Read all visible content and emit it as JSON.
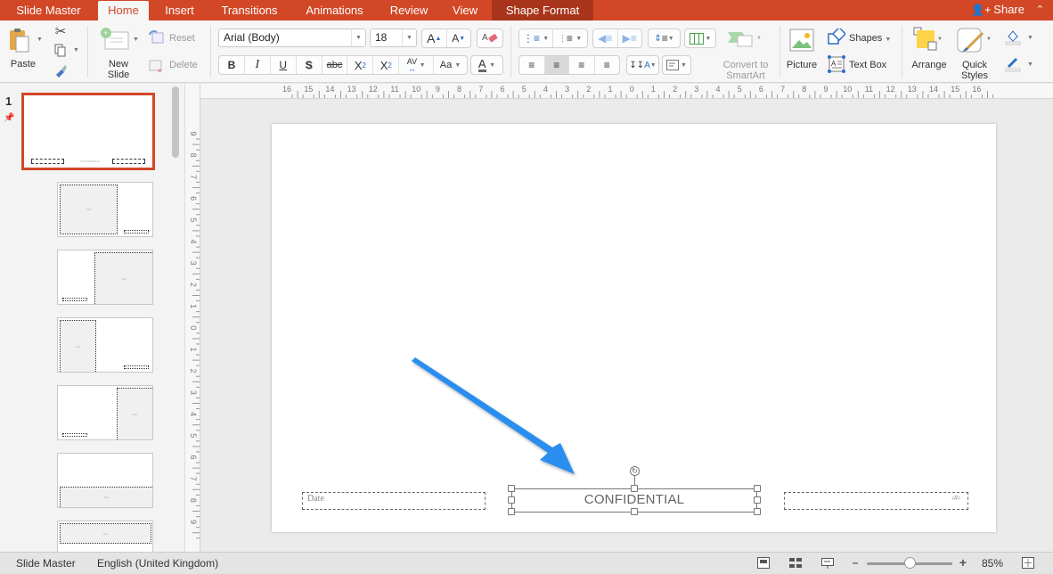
{
  "tabs": [
    {
      "label": "Slide Master",
      "state": "normal"
    },
    {
      "label": "Home",
      "state": "active"
    },
    {
      "label": "Insert",
      "state": "normal"
    },
    {
      "label": "Transitions",
      "state": "normal"
    },
    {
      "label": "Animations",
      "state": "normal"
    },
    {
      "label": "Review",
      "state": "normal"
    },
    {
      "label": "View",
      "state": "normal"
    },
    {
      "label": "Shape Format",
      "state": "contextual"
    }
  ],
  "share": {
    "label": "Share",
    "icon": "add-person-icon"
  },
  "colors": {
    "accent": "#d24726",
    "contextual_tab": "#a8341b",
    "arrow": "#2b8ef0",
    "ribbon_bg": "#f6f6f6"
  },
  "ribbon": {
    "clipboard": {
      "paste": "Paste",
      "cut_icon": "scissors-icon",
      "copy_icon": "copy-icon",
      "format_painter_icon": "paintbrush-icon"
    },
    "slides": {
      "new_slide": "New Slide",
      "reset": "Reset",
      "delete": "Delete"
    },
    "font": {
      "name": "Arial (Body)",
      "size": "18",
      "grow": "A",
      "shrink": "A",
      "bold": "B",
      "italic": "I",
      "underline": "U",
      "shadow": "S",
      "strike": "abc",
      "superscript": "X",
      "subscript": "X",
      "sup_mark": "2",
      "sub_mark": "2",
      "spacing": "AV",
      "change_case": "Aa",
      "color": "A"
    },
    "paragraph": {
      "convert_smartart_line1": "Convert to",
      "convert_smartart_line2": "SmartArt",
      "alignment_selected": "center"
    },
    "insert": {
      "picture": "Picture",
      "shapes": "Shapes",
      "text_box": "Text Box"
    },
    "drawing": {
      "arrange": "Arrange",
      "quick_styles_line1": "Quick",
      "quick_styles_line2": "Styles"
    }
  },
  "thumbnails": {
    "slide_number": "1",
    "items": [
      {
        "layout": "master",
        "selected": true
      },
      {
        "layout": "picture-left"
      },
      {
        "layout": "picture-right"
      },
      {
        "layout": "narrow-left"
      },
      {
        "layout": "narrow-right"
      },
      {
        "layout": "bottom-band"
      },
      {
        "layout": "top-band"
      }
    ],
    "placeholder_text": "Text"
  },
  "rulers": {
    "horizontal": [
      "16",
      "15",
      "14",
      "13",
      "12",
      "11",
      "10",
      "9",
      "8",
      "7",
      "6",
      "5",
      "4",
      "3",
      "2",
      "1",
      "0",
      "1",
      "2",
      "3",
      "4",
      "5",
      "6",
      "7",
      "8",
      "9",
      "10",
      "11",
      "12",
      "13",
      "14",
      "15",
      "16"
    ],
    "vertical": [
      "9",
      "8",
      "7",
      "6",
      "5",
      "4",
      "3",
      "2",
      "1",
      "0",
      "1",
      "2",
      "3",
      "4",
      "5",
      "6",
      "7",
      "8",
      "9"
    ]
  },
  "slide": {
    "date_placeholder": "Date",
    "footer_text": "CONFIDENTIAL",
    "slide_number_placeholder": "‹#›"
  },
  "status": {
    "view": "Slide Master",
    "language": "English (United Kingdom)",
    "zoom": "85%",
    "zoom_value": 0.5
  }
}
